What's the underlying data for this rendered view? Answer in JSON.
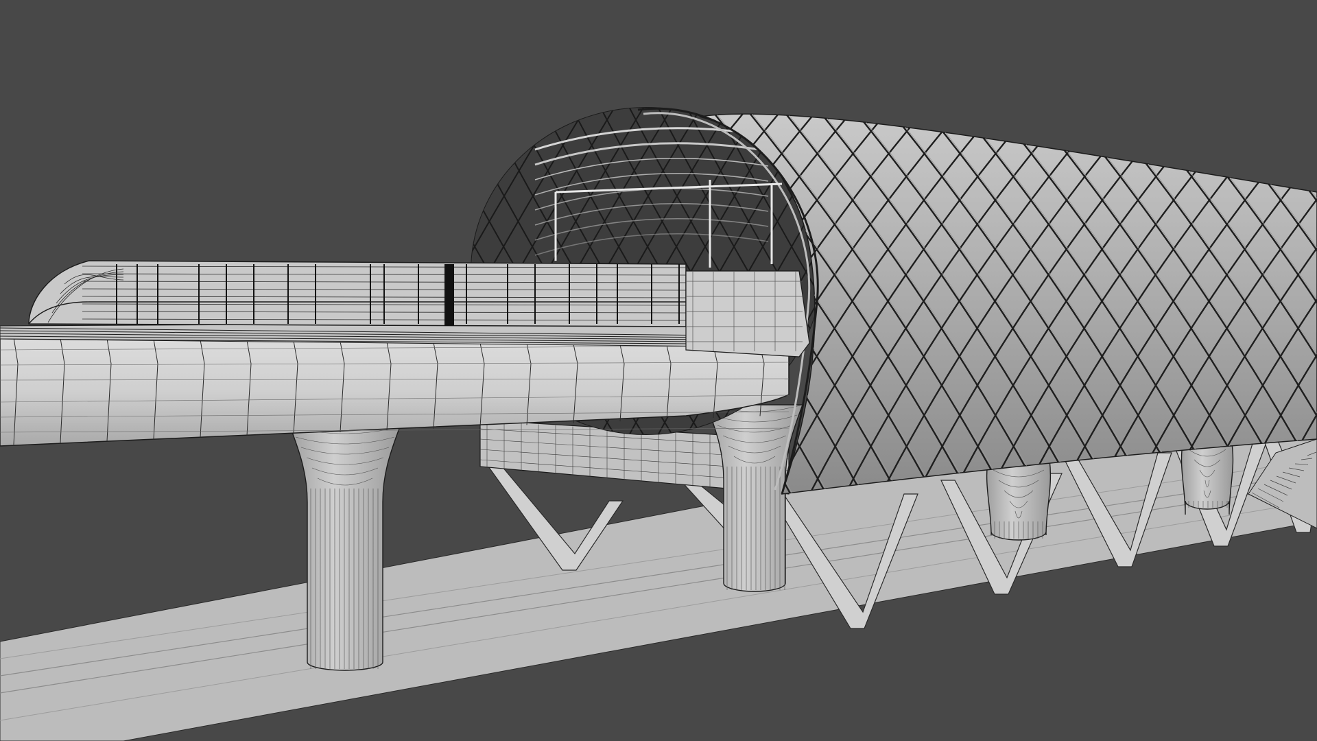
{
  "viewport": {
    "background_color": "#484848",
    "scene": "wireframe-3d-model",
    "scene_objects": [
      "ground-plane",
      "elevated-track-beam",
      "support-pillar",
      "maglev-train",
      "station-canopy-diagrid",
      "station-platform",
      "v-truss-supports",
      "escalator"
    ]
  },
  "colors": {
    "background": "#484848",
    "ground": "#bcbcbc",
    "ground_line": "#8c8c8c",
    "surface_light": "#d6d6d6",
    "surface_mid": "#b2b2b2",
    "surface_dark": "#8f8f8f",
    "wire": "#1c1c1c",
    "canopy_interior": "#333333",
    "canopy_rib": "#eeeeee"
  }
}
